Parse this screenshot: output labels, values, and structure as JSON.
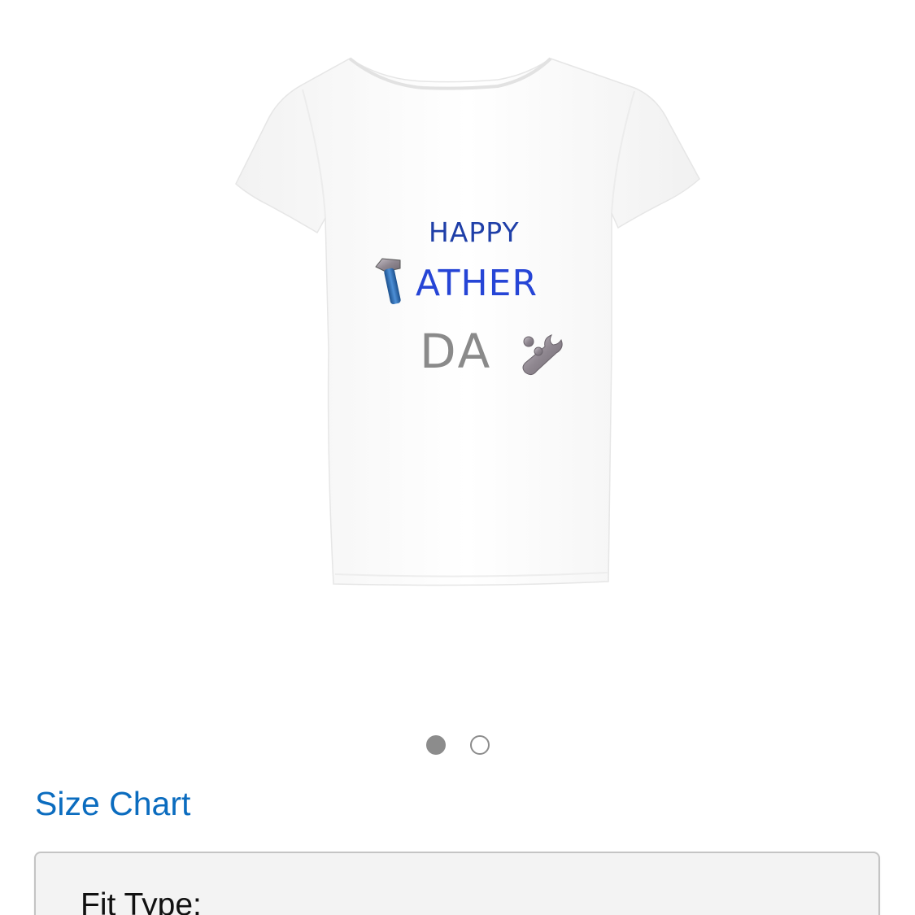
{
  "product_image": {
    "alt_icon": "tshirt-product-photo",
    "print": {
      "line1": "HAPPY",
      "line2": "ATHER",
      "line3": "DA",
      "left_icon": "hammer-icon",
      "right_icon": "wrench-icon"
    }
  },
  "carousel": {
    "count": 2,
    "active_index": 0
  },
  "size_chart": {
    "label": "Size Chart"
  },
  "fit_type": {
    "label": "Fit Type:"
  },
  "colors": {
    "link": "#0b6cbf",
    "print_blue": "#2645d6",
    "print_gray": "#8a8a8a",
    "dot": "#8c8c8c",
    "box_bg": "#f3f3f3",
    "box_border": "#c4c4c4"
  }
}
